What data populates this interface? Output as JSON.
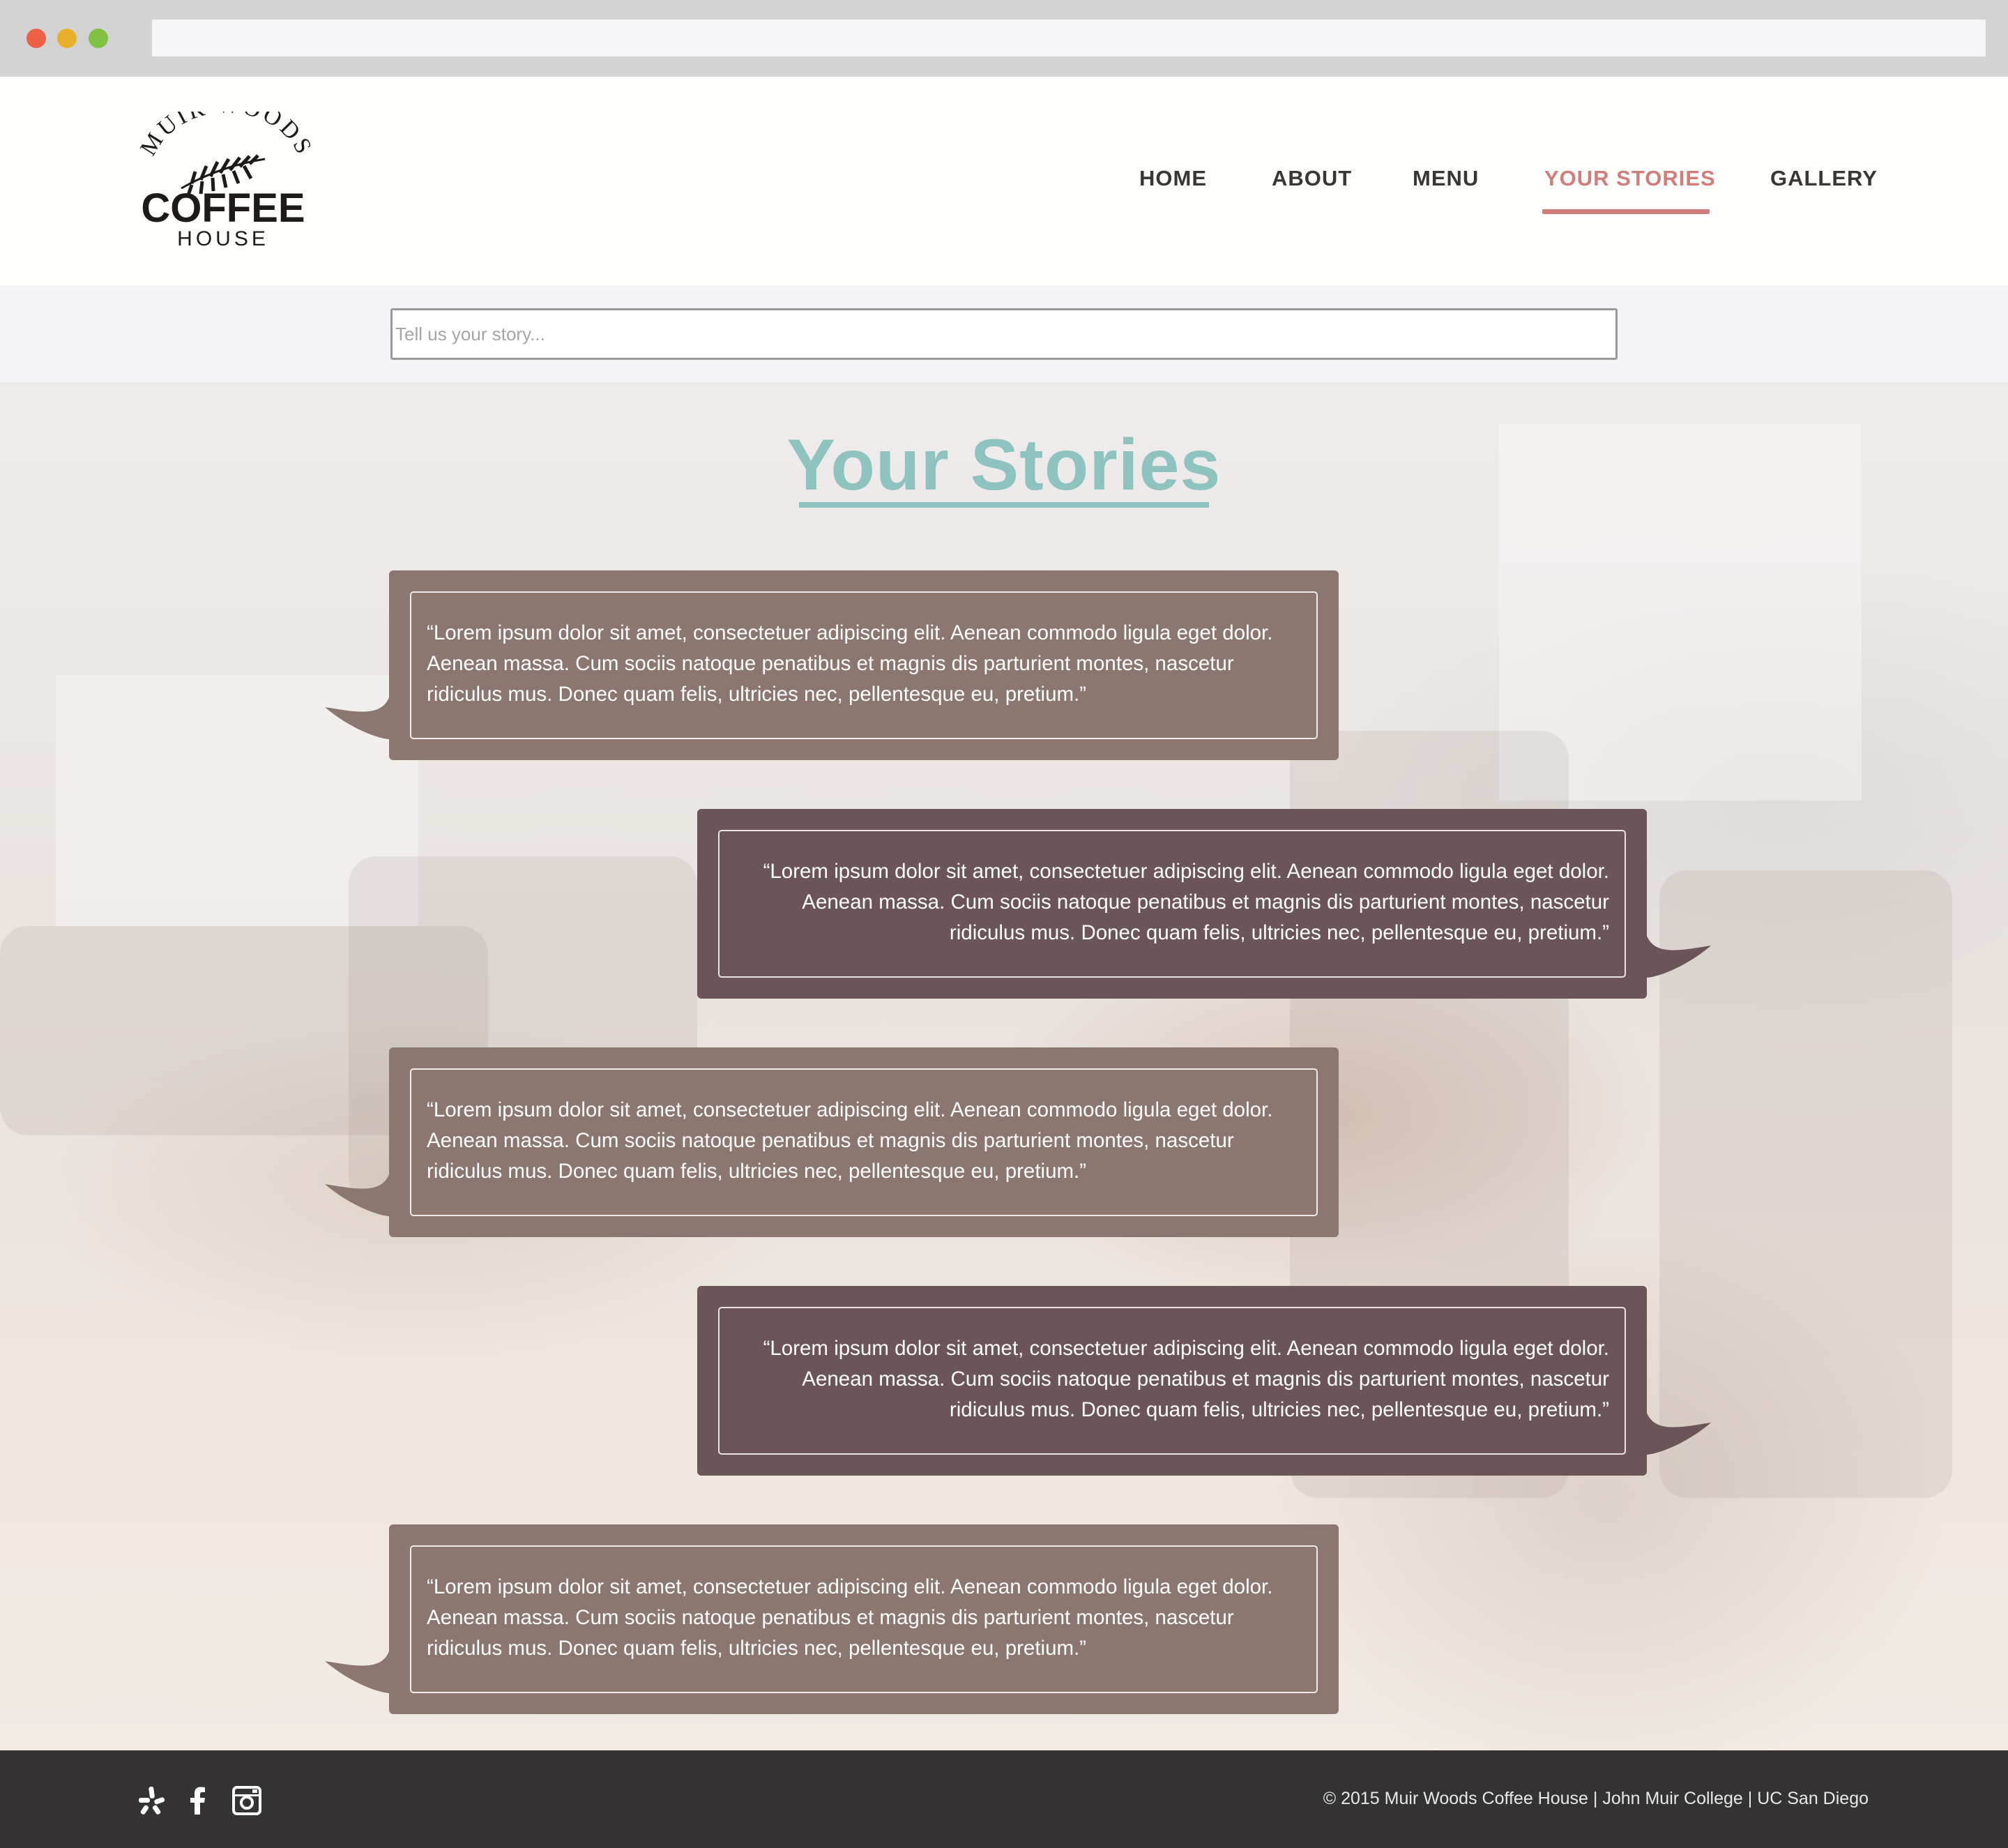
{
  "site": {
    "logo": {
      "line1": "MUIR WOODS",
      "line2": "COFFEE",
      "line3": "HOUSE",
      "icon": "coffee-leaf-icon"
    }
  },
  "nav": {
    "items": [
      {
        "label": "HOME"
      },
      {
        "label": "ABOUT"
      },
      {
        "label": "MENU"
      },
      {
        "label": "YOUR STORIES",
        "active": true
      },
      {
        "label": "GALLERY"
      }
    ]
  },
  "story_input": {
    "placeholder": "Tell us your story..."
  },
  "main": {
    "title": "Your Stories",
    "stories": [
      {
        "text": "“Lorem ipsum dolor sit amet, consectetuer adipiscing elit. Aenean commodo ligula eget dolor. Aenean massa. Cum sociis natoque penatibus et magnis dis parturient montes, nascetur ridiculus mus. Donec quam felis, ultricies nec, pellentesque eu, pretium.”",
        "side": "left"
      },
      {
        "text": "“Lorem ipsum dolor sit amet, consectetuer adipiscing elit. Aenean commodo ligula eget dolor. Aenean massa. Cum sociis natoque penatibus et magnis dis parturient montes, nascetur ridiculus mus. Donec quam felis, ultricies nec, pellentesque eu, pretium.”",
        "side": "right"
      },
      {
        "text": "“Lorem ipsum dolor sit amet, consectetuer adipiscing elit. Aenean commodo ligula eget dolor. Aenean massa. Cum sociis natoque penatibus et magnis dis parturient montes, nascetur ridiculus mus. Donec quam felis, ultricies nec, pellentesque eu, pretium.”",
        "side": "left"
      },
      {
        "text": "“Lorem ipsum dolor sit amet, consectetuer adipiscing elit. Aenean commodo ligula eget dolor. Aenean massa. Cum sociis natoque penatibus et magnis dis parturient montes, nascetur ridiculus mus. Donec quam felis, ultricies nec, pellentesque eu, pretium.”",
        "side": "right"
      },
      {
        "text": "“Lorem ipsum dolor sit amet, consectetuer adipiscing elit. Aenean commodo ligula eget dolor. Aenean massa. Cum sociis natoque penatibus et magnis dis parturient montes, nascetur ridiculus mus. Donec quam felis, ultricies nec, pellentesque eu, pretium.”",
        "side": "left"
      }
    ]
  },
  "footer": {
    "social": [
      {
        "icon": "yelp-icon"
      },
      {
        "icon": "facebook-icon"
      },
      {
        "icon": "instagram-icon"
      }
    ],
    "copyright": "© 2015 Muir Woods Coffee House | John Muir College | UC San Diego"
  },
  "colors": {
    "accent_nav": "#cf7f7b",
    "title_teal": "#8ec3c0",
    "bubble_light": "#8c7670",
    "bubble_dark": "#6c5558",
    "footer_bg": "#343232"
  }
}
